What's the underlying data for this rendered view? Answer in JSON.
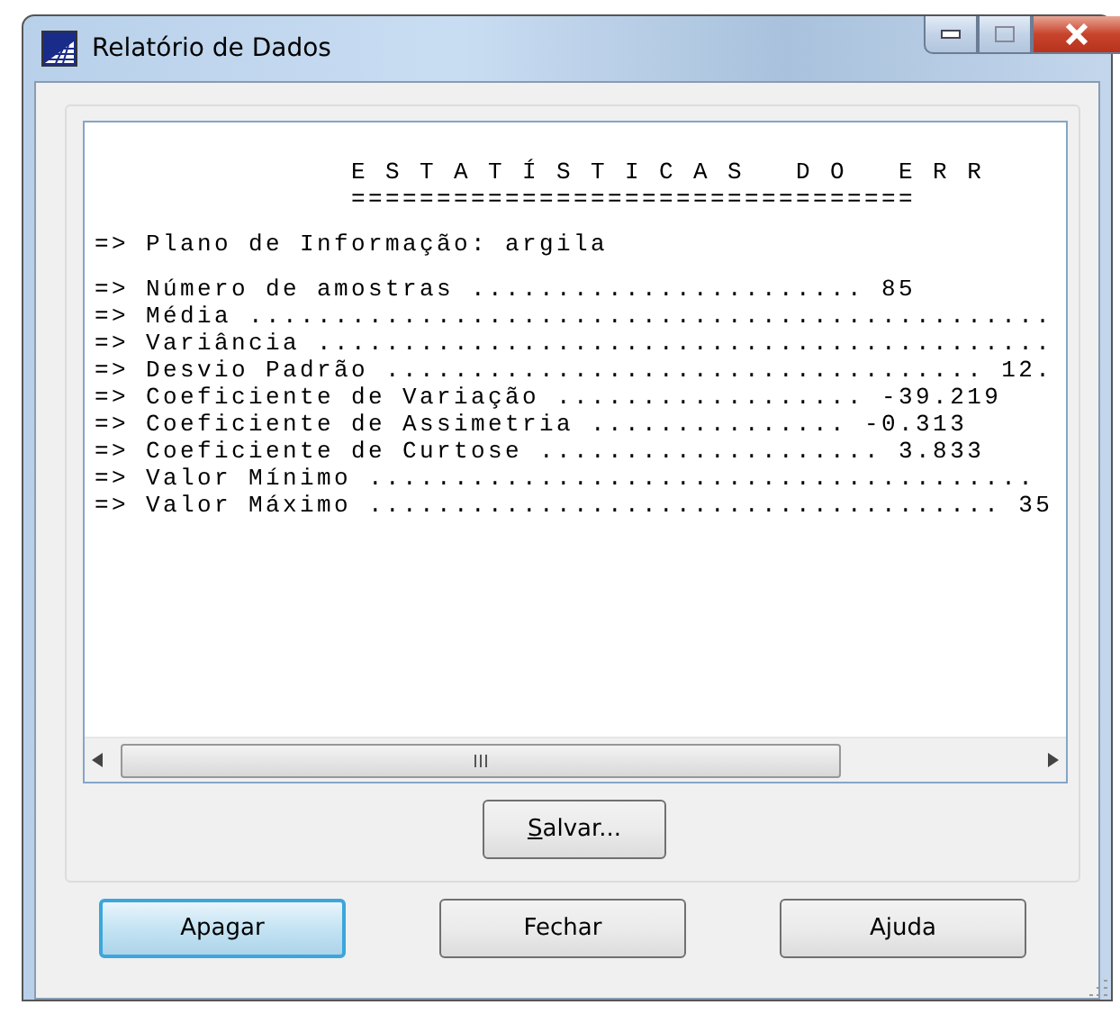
{
  "window": {
    "title": "Relatório de Dados"
  },
  "report": {
    "sections": [
      [
        "               E S T A T Í S T I C A S   D O   E R R",
        "               ================================="
      ],
      [
        "=> Plano de Informação: argila"
      ],
      [
        "=> Número de amostras ....................... 85",
        "=> Média ...............................................",
        "=> Variância ...........................................",
        "=> Desvio Padrão ................................... 12.",
        "=> Coeficiente de Variação .................. -39.219",
        "=> Coeficiente de Assimetria ............... -0.313",
        "=> Coeficiente de Curtose .................... 3.833",
        "=> Valor Mínimo .......................................",
        "=> Valor Máximo ..................................... 35"
      ]
    ]
  },
  "save_button": {
    "label": "Salvar...",
    "underline_first": true
  },
  "buttons": [
    {
      "label": "Apagar",
      "default": true
    },
    {
      "label": "Fechar",
      "default": false
    },
    {
      "label": "Ajuda",
      "default": false
    }
  ]
}
